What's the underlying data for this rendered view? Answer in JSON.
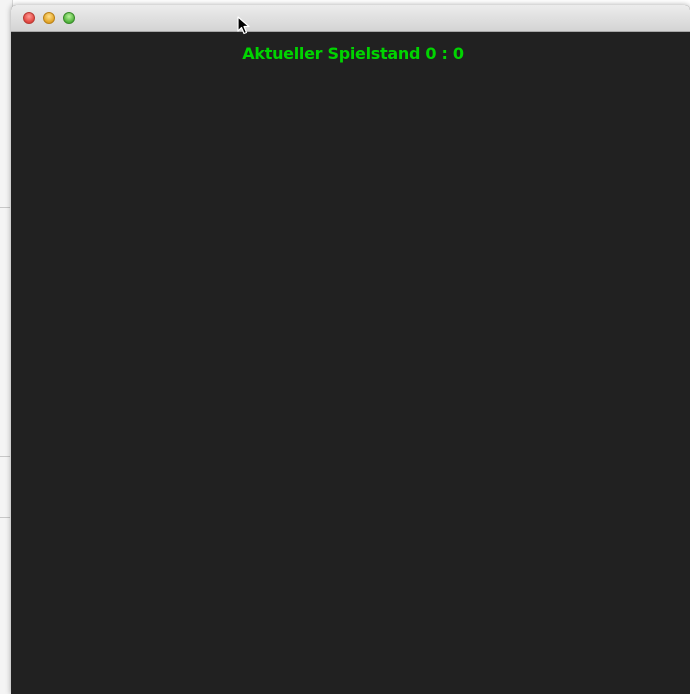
{
  "game": {
    "score_label": "Aktueller Spielstand 0 : 0"
  },
  "colors": {
    "score_text": "#00d400",
    "background": "#212121"
  },
  "icons": {
    "close": "close-icon",
    "minimize": "minimize-icon",
    "zoom": "zoom-icon",
    "cursor": "mouse-pointer-icon"
  }
}
